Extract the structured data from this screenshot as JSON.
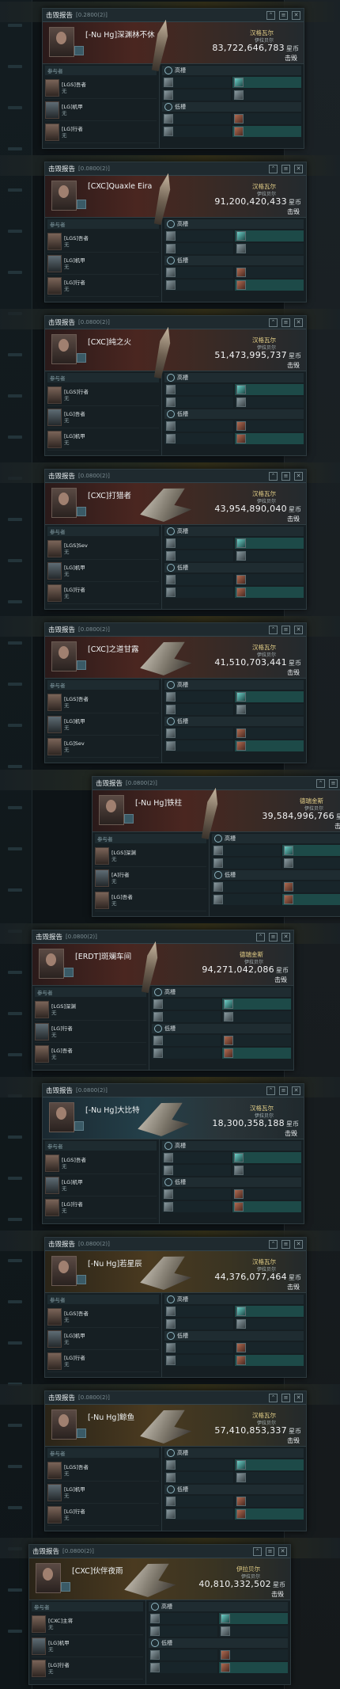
{
  "texts": {
    "panel_title": "击毁报告",
    "destroyed": "击毁",
    "isk_unit": "星币",
    "attackers_header": "参与者",
    "slot_high": "高槽",
    "slot_mid": "低槽"
  },
  "panels": [
    {
      "id": "[0.2800(2)]",
      "victim": "[-Nu Hg]深渊林不休",
      "loc": "汉格瓦尔",
      "loc_sub": "伊拉贝尔",
      "isk": "83,722,646,783",
      "attackers": [
        {
          "name": "[LGS]吾者",
          "sub": "无"
        },
        {
          "name": "[LG]机甲",
          "sub": "无"
        },
        {
          "name": "[LG]行者",
          "sub": "无"
        }
      ]
    },
    {
      "id": "[0.0800(2)]",
      "victim": "[CXC]Quaxle Eira",
      "loc": "汉格瓦尔",
      "loc_sub": "伊拉贝尔",
      "isk": "91,200,420,433",
      "attackers": [
        {
          "name": "[LGS]吾者",
          "sub": "无"
        },
        {
          "name": "[LG]机甲",
          "sub": "无"
        },
        {
          "name": "[LG]行者",
          "sub": "无"
        }
      ]
    },
    {
      "id": "[0.0800(2)]",
      "victim": "[CXC]纯之火",
      "loc": "汉格瓦尔",
      "loc_sub": "伊拉贝尔",
      "isk": "51,473,995,737",
      "attackers": [
        {
          "name": "[LGS]行者",
          "sub": "无"
        },
        {
          "name": "[LG]吾者",
          "sub": "无"
        },
        {
          "name": "[LG]机甲",
          "sub": "无"
        }
      ]
    },
    {
      "id": "[0.0800(2)]",
      "victim": "[CXC]打猎者",
      "loc": "汉格瓦尔",
      "loc_sub": "伊拉贝尔",
      "isk": "43,954,890,040",
      "attackers": [
        {
          "name": "[LGS]Sev",
          "sub": "无"
        },
        {
          "name": "[LG]机甲",
          "sub": "无"
        },
        {
          "name": "[LG]行者",
          "sub": "无"
        }
      ]
    },
    {
      "id": "[0.0800(2)]",
      "victim": "[CXC]之道甘露",
      "loc": "汉格瓦尔",
      "loc_sub": "伊拉贝尔",
      "isk": "41,510,703,441",
      "attackers": [
        {
          "name": "[LGS]吾者",
          "sub": "无"
        },
        {
          "name": "[LG]机甲",
          "sub": "无"
        },
        {
          "name": "[LG]Sev",
          "sub": "无"
        }
      ]
    },
    {
      "id": "[0.0800(2)]",
      "victim": "[-Nu Hg]铁柱",
      "loc": "德瑞金斯",
      "loc_sub": "伊拉贝尔",
      "isk": "39,584,996,766",
      "attackers": [
        {
          "name": "[LGS]深渊",
          "sub": "无"
        },
        {
          "name": "[A]行者",
          "sub": "无"
        },
        {
          "name": "[LG]吾者",
          "sub": "无"
        }
      ]
    },
    {
      "id": "[0.0800(2)]",
      "victim": "[ERDT]斑斓车间",
      "loc": "德瑞金斯",
      "loc_sub": "伊拉贝尔",
      "isk": "94,271,042,086",
      "attackers": [
        {
          "name": "[LGS]深渊",
          "sub": "无"
        },
        {
          "name": "[LG]行者",
          "sub": "无"
        },
        {
          "name": "[LG]吾者",
          "sub": "无"
        }
      ]
    },
    {
      "id": "[0.0800(2)]",
      "victim": "[-Nu Hg]大比特",
      "loc": "汉格瓦尔",
      "loc_sub": "伊拉贝尔",
      "isk": "18,300,358,188",
      "attackers": [
        {
          "name": "[LGS]吾者",
          "sub": "无"
        },
        {
          "name": "[LG]机甲",
          "sub": "无"
        },
        {
          "name": "[LG]行者",
          "sub": "无"
        }
      ]
    },
    {
      "id": "[0.0800(2)]",
      "victim": "[-Nu Hg]若星辰",
      "loc": "汉格瓦尔",
      "loc_sub": "伊拉贝尔",
      "isk": "44,376,077,464",
      "attackers": [
        {
          "name": "[LGS]吾者",
          "sub": "无"
        },
        {
          "name": "[LG]机甲",
          "sub": "无"
        },
        {
          "name": "[LG]行者",
          "sub": "无"
        }
      ]
    },
    {
      "id": "[0.0800(2)]",
      "victim": "[-Nu Hg]鲸鱼",
      "loc": "汉格瓦尔",
      "loc_sub": "伊拉贝尔",
      "isk": "57,410,853,337",
      "attackers": [
        {
          "name": "[LGS]吾者",
          "sub": "无"
        },
        {
          "name": "[LG]机甲",
          "sub": "无"
        },
        {
          "name": "[LG]行者",
          "sub": "无"
        }
      ]
    },
    {
      "id": "[0.0800(2)]",
      "victim": "[CXC]伙伴夜雨",
      "loc": "伊拉贝尔",
      "loc_sub": "伊拉贝尔",
      "isk": "40,810,332,502",
      "attackers": [
        {
          "name": "[CXC]主将",
          "sub": "无"
        },
        {
          "name": "[LG]机甲",
          "sub": "无"
        },
        {
          "name": "[LG]行者",
          "sub": "无"
        }
      ]
    }
  ]
}
